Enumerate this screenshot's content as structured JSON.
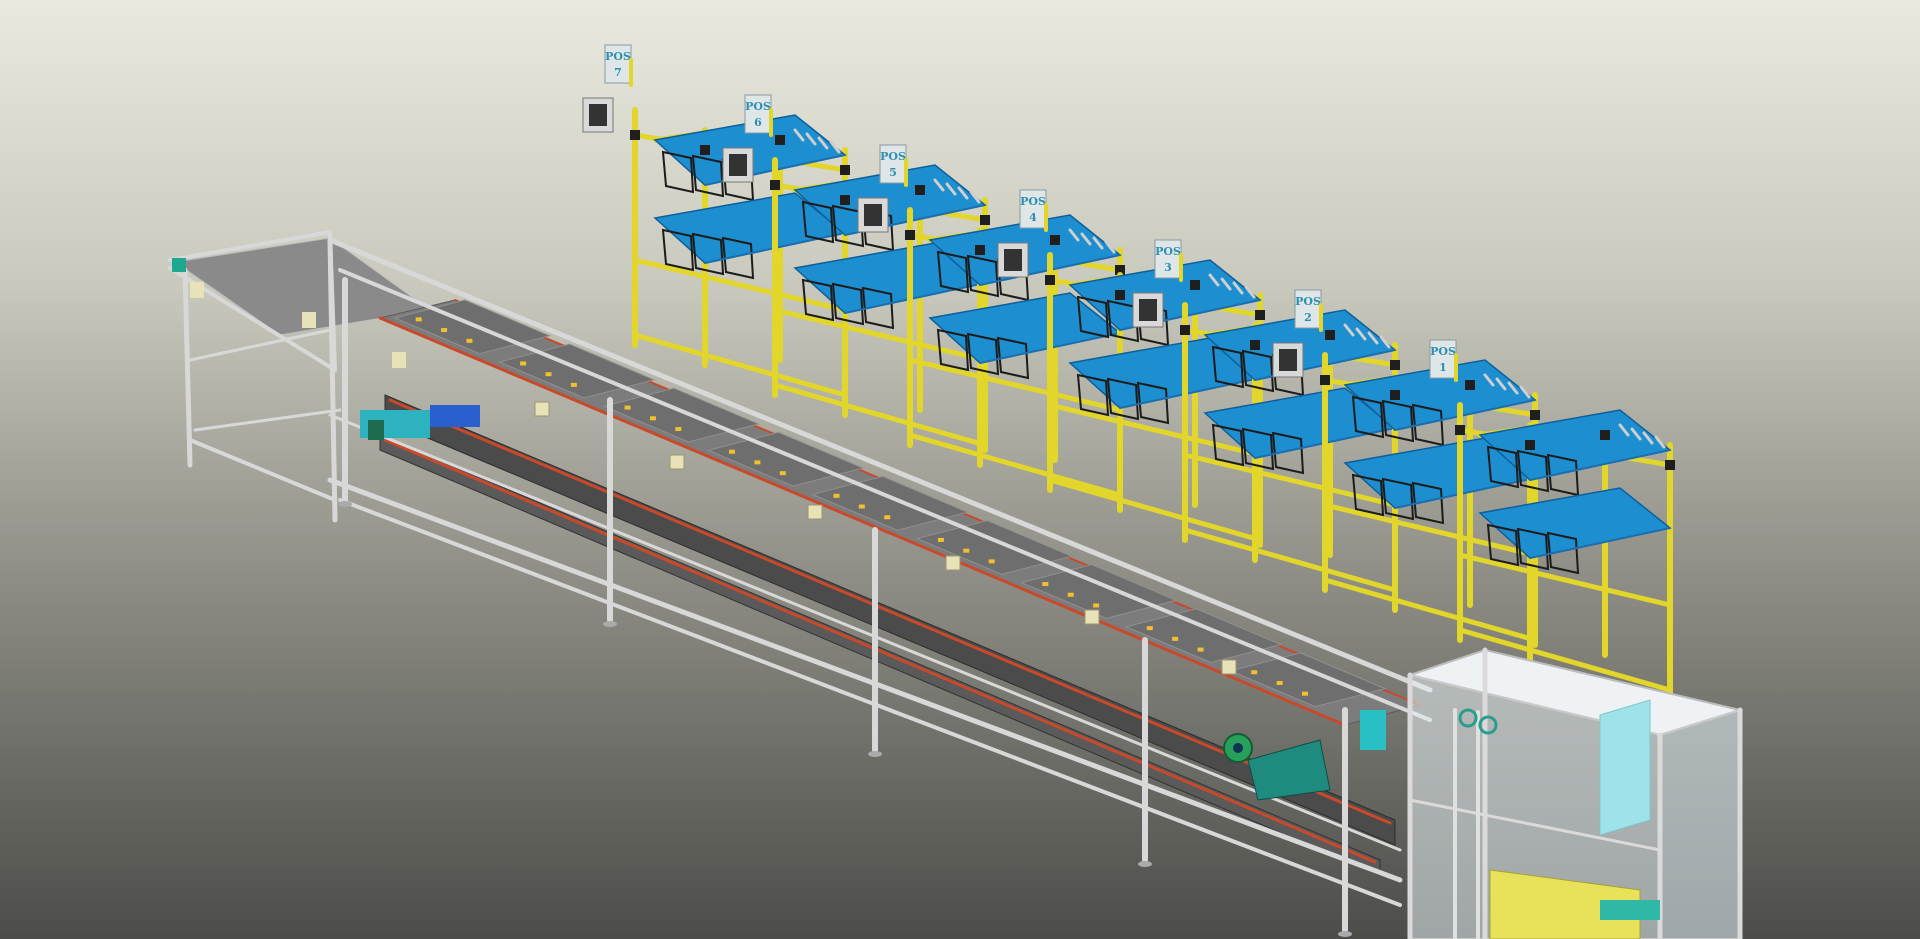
{
  "scene": {
    "stations": [
      {
        "label": "POS",
        "number": "7"
      },
      {
        "label": "POS",
        "number": "6"
      },
      {
        "label": "POS",
        "number": "5"
      },
      {
        "label": "POS",
        "number": "4"
      },
      {
        "label": "POS",
        "number": "3"
      },
      {
        "label": "POS",
        "number": "2"
      },
      {
        "label": "POS",
        "number": "1"
      }
    ],
    "colors": {
      "rack_frame": "#e2d62a",
      "bins": "#1d8fd0",
      "conveyor_belt": "#7c7c7c",
      "aluminium_frame": "#d8d8d8",
      "chain": "#c94a2a",
      "enclosure_glass": "#e6eef2"
    }
  }
}
